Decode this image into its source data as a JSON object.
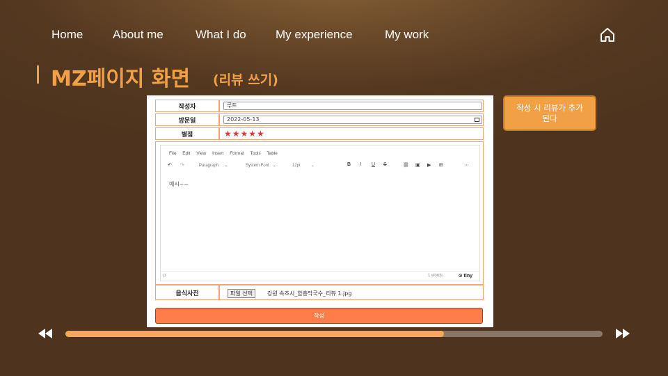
{
  "nav": {
    "items": [
      "Home",
      "About me",
      "What I do",
      "My experience",
      "My work"
    ],
    "home_icon": "home-icon"
  },
  "title": {
    "main": "MZ페이지 화면",
    "sub": "(리뷰 쓰기)"
  },
  "form": {
    "author_label": "작성자",
    "author_value": "루트",
    "date_label": "방문일",
    "date_value": "2022-05-13",
    "rating_label": "별점",
    "rating_stars": "★★★★★",
    "rating_value": 5,
    "editor": {
      "menu": [
        "File",
        "Edit",
        "View",
        "Insert",
        "Format",
        "Tools",
        "Table"
      ],
      "block_format": "Paragraph",
      "font_family": "System Font",
      "font_size": "12pt",
      "content": "예시~~",
      "path": "p",
      "word_count": "1 words",
      "brand": "tiny"
    },
    "photo_label": "음식사진",
    "file_button": "파일 선택",
    "file_name": "강원 속초시_함흥막국수_리뷰 1.jpg",
    "submit_label": "작성"
  },
  "annotation": "작성 시 리뷰가 추가된다",
  "player": {
    "progress": 0.705
  },
  "colors": {
    "accent": "#f2a046",
    "highlight_border": "#f3a27a",
    "submit": "#ff7d4a",
    "star": "#e53935"
  }
}
